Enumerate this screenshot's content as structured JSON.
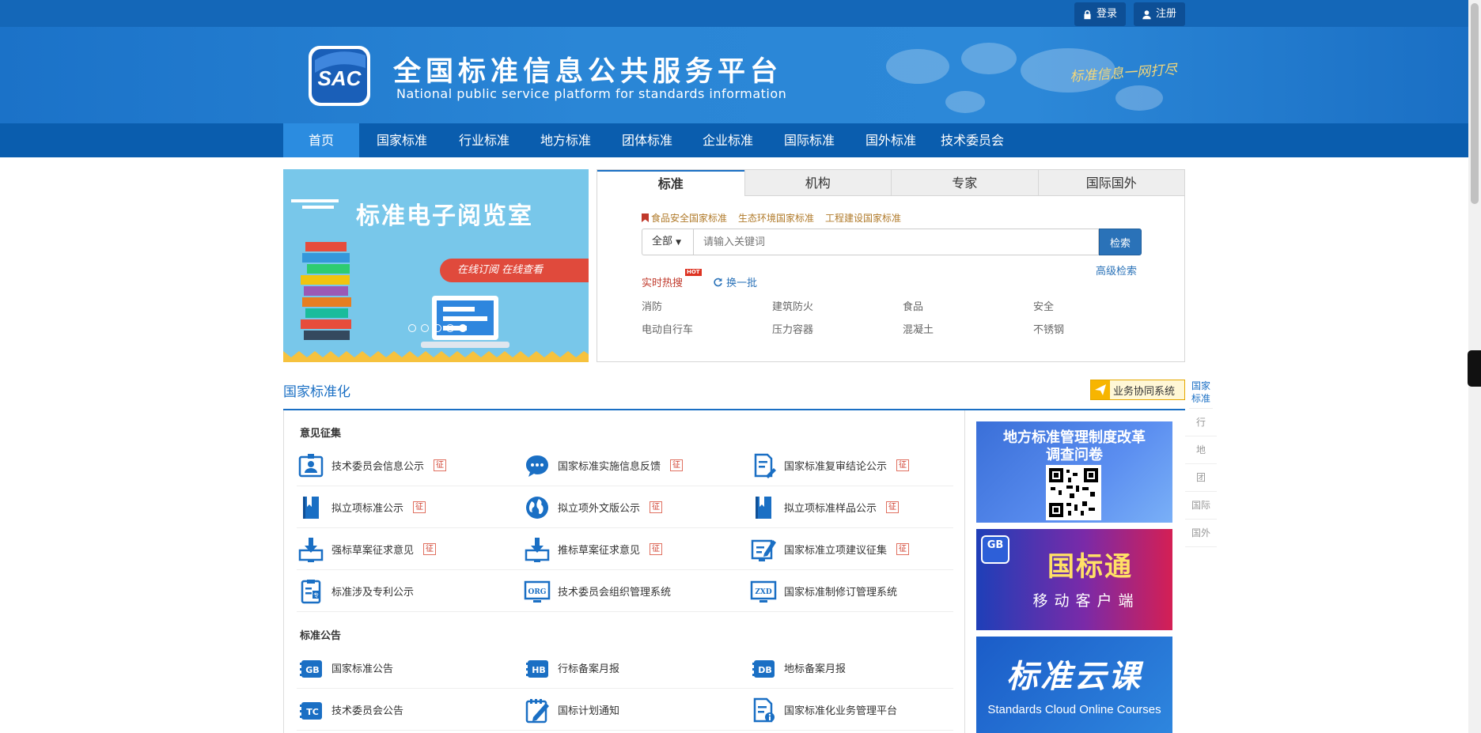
{
  "topbar": {
    "login_label": "登录",
    "register_label": "注册"
  },
  "header": {
    "logo_text": "SAC",
    "title": "全国标准信息公共服务平台",
    "subtitle": "National public service platform  for standards information",
    "slogan": "标准信息一网打尽"
  },
  "nav": {
    "items": [
      "首页",
      "国家标准",
      "行业标准",
      "地方标准",
      "团体标准",
      "企业标准",
      "国际标准",
      "国外标准",
      "技术委员会"
    ]
  },
  "carousel": {
    "title": "标准电子阅览室",
    "ribbon": "在线订阅   在线查看",
    "dots": 5,
    "active_dot": 4
  },
  "search": {
    "tabs": [
      "标准",
      "机构",
      "专家",
      "国际国外"
    ],
    "quick_links": [
      "食品安全国家标准",
      "生态环境国家标准",
      "工程建设国家标准"
    ],
    "scope_label": "全部",
    "placeholder": "请输入关键词",
    "button_label": "检索",
    "advanced_label": "高级检索",
    "hot_label": "实时热搜",
    "hot_tag": "HOT",
    "refresh_label": "换一批",
    "hot_terms": [
      "消防",
      "建筑防火",
      "食品",
      "安全",
      "电动自行车",
      "压力容器",
      "混凝土",
      "不锈钢"
    ]
  },
  "section": {
    "title": "国家标准化",
    "biz_button": "业务协同系统"
  },
  "side_nav": [
    "国家标准",
    "行",
    "地",
    "团",
    "国际",
    "国外"
  ],
  "groups": {
    "opinion": {
      "label": "意见征集",
      "rows": [
        [
          {
            "text": "技术委员会信息公示",
            "tag": "征"
          },
          {
            "text": "国家标准实施信息反馈",
            "tag": "征"
          },
          {
            "text": "国家标准复审结论公示",
            "tag": "征"
          }
        ],
        [
          {
            "text": "拟立项标准公示",
            "tag": "征"
          },
          {
            "text": "拟立项外文版公示",
            "tag": "征"
          },
          {
            "text": "拟立项标准样品公示",
            "tag": "征"
          }
        ],
        [
          {
            "text": "强标草案征求意见",
            "tag": "征"
          },
          {
            "text": "推标草案征求意见",
            "tag": "征"
          },
          {
            "text": "国家标准立项建议征集",
            "tag": "征"
          }
        ],
        [
          {
            "text": "标准涉及专利公示"
          },
          {
            "text": "技术委员会组织管理系统"
          },
          {
            "text": "国家标准制修订管理系统"
          }
        ]
      ]
    },
    "notice": {
      "label": "标准公告",
      "rows": [
        [
          {
            "text": "国家标准公告"
          },
          {
            "text": "行标备案月报"
          },
          {
            "text": "地标备案月报"
          }
        ],
        [
          {
            "text": "技术委员会公告"
          },
          {
            "text": "国标计划通知"
          },
          {
            "text": "国家标准化业务管理平台"
          }
        ]
      ]
    }
  },
  "icons": {
    "row_icons": [
      [
        "id-card-icon",
        "chat-bubble-icon",
        "document-pen-icon"
      ],
      [
        "bookmark-book-icon",
        "globe-icon",
        "bookmark-book-icon"
      ],
      [
        "download-monitor-icon",
        "download-monitor-icon",
        "edit-monitor-icon"
      ],
      [
        "patent-document-icon",
        "org-monitor-icon",
        "zxd-monitor-icon"
      ],
      [
        "gb-stack-icon",
        "hb-stack-icon",
        "db-stack-icon"
      ],
      [
        "tc-stack-icon",
        "pencil-note-icon",
        "document-info-icon"
      ]
    ],
    "badges": {
      "org": "ORG",
      "zxd": "ZXD",
      "gb": "GB",
      "hb": "HB",
      "db": "DB",
      "tc": "TC",
      "patent": "专"
    }
  },
  "ads": {
    "survey_title_1": "地方标准管理制度改革",
    "survey_title_2": "调查问卷",
    "app_badge": "GB",
    "app_title": "国标通",
    "app_subtitle": "移动客户端",
    "course_title": "标准云课",
    "course_subtitle": "Standards Cloud Online Courses"
  },
  "colors": {
    "primary": "#1a6fc4",
    "nav": "#0a5dae",
    "nav_active": "#2b8ce0",
    "hot": "#c0392b",
    "link_gold": "#b07a2a"
  }
}
